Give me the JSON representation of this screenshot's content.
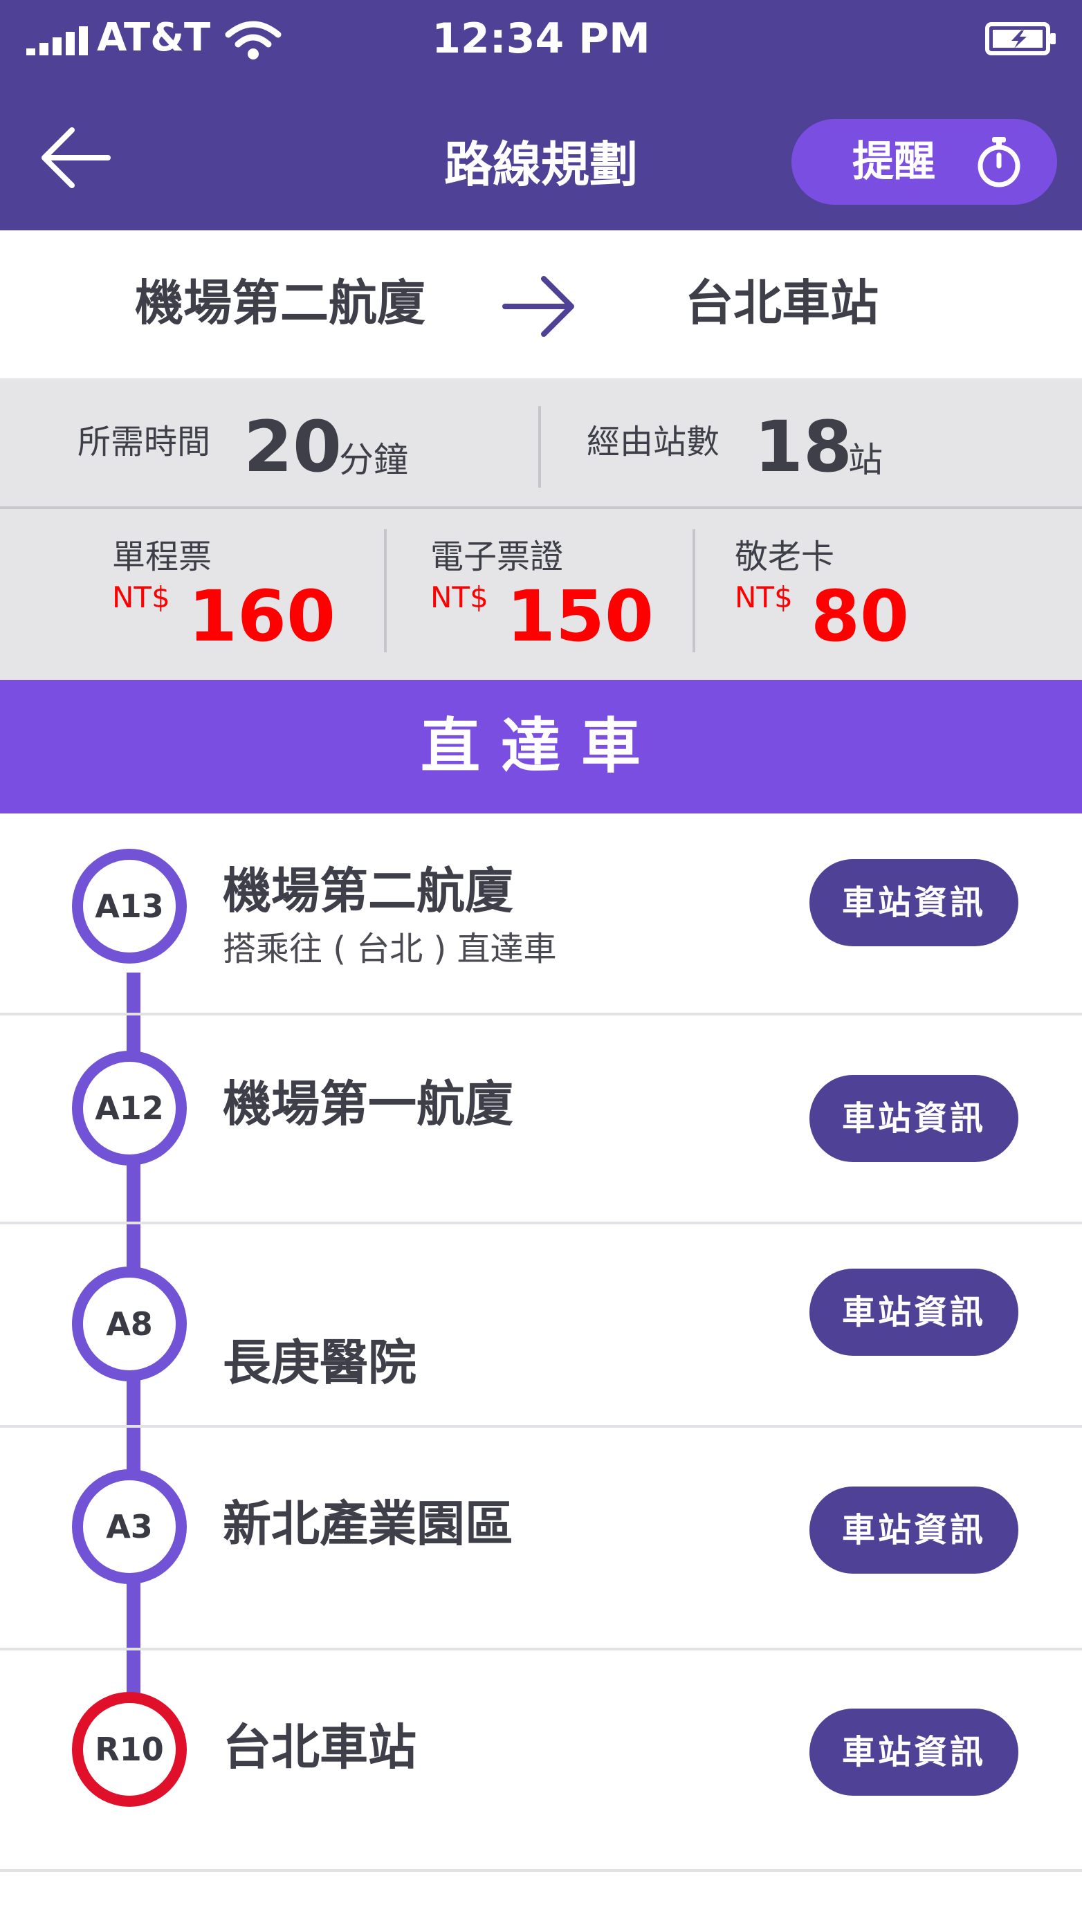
{
  "status_bar": {
    "carrier": "AT&T",
    "time": "12:34 PM"
  },
  "header": {
    "title": "路線規劃",
    "remind_label": "提醒"
  },
  "route": {
    "from": "機場第二航廈",
    "to": "台北車站"
  },
  "summary": {
    "time_label": "所需時間",
    "time_value": "20",
    "time_unit": "分鐘",
    "stops_label": "經由站數",
    "stops_value": "18",
    "stops_unit": "站"
  },
  "fares": [
    {
      "label": "單程票",
      "currency": "NT$",
      "value": "160"
    },
    {
      "label": "電子票證",
      "currency": "NT$",
      "value": "150"
    },
    {
      "label": "敬老卡",
      "currency": "NT$",
      "value": "80"
    }
  ],
  "service_type": "直達車",
  "stations": [
    {
      "code": "A13",
      "name": "機場第二航廈",
      "subtitle": "搭乘往 ( 台北 ) 直達車",
      "button": "車站資訊"
    },
    {
      "code": "A12",
      "name": "機場第一航廈",
      "button": "車站資訊"
    },
    {
      "code": "A8",
      "name": "長庚醫院",
      "button": "車站資訊"
    },
    {
      "code": "A3",
      "name": "新北產業園區",
      "button": "車站資訊"
    },
    {
      "code": "R10",
      "name": "台北車站",
      "button": "車站資訊"
    }
  ],
  "colors": {
    "header": "#4f4196",
    "accent": "#7a4ee0",
    "line": "#7253d6",
    "price": "#ff0000",
    "end_station": "#e0102a"
  }
}
